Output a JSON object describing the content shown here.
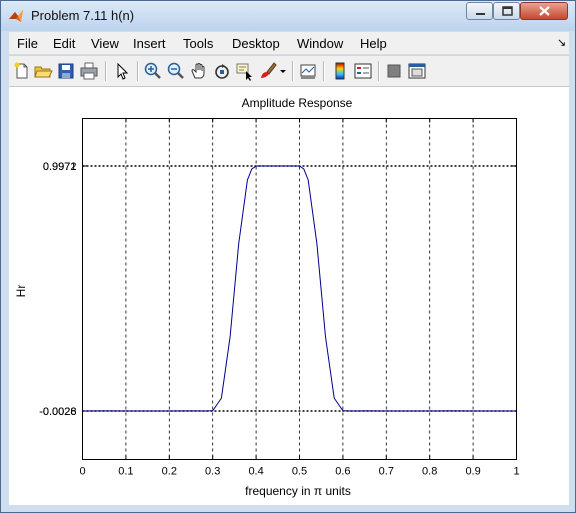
{
  "window": {
    "title": "Problem 7.11 h(n)",
    "controls": [
      "minimize",
      "maximize",
      "close"
    ]
  },
  "menubar": {
    "items": [
      "File",
      "Edit",
      "View",
      "Insert",
      "Tools",
      "Desktop",
      "Window",
      "Help"
    ],
    "dock_arrow": "↘"
  },
  "toolbar": {
    "buttons": [
      "new-figure-icon",
      "open-file-icon",
      "save-icon",
      "print-icon",
      "edit-plot-arrow-icon",
      "zoom-in-icon",
      "zoom-out-icon",
      "pan-hand-icon",
      "rotate-3d-icon",
      "data-cursor-icon",
      "brush-icon",
      "link-plot-icon",
      "colorbar-icon",
      "legend-icon",
      "hide-plot-tools-icon",
      "show-plot-tools-icon"
    ]
  },
  "chart_data": {
    "type": "line",
    "title": "Amplitude Response",
    "xlabel": "frequency in π units",
    "ylabel": "Hr",
    "xlim": [
      0,
      1
    ],
    "ylim": [
      -0.0028,
      0.9972
    ],
    "xticks": [
      0,
      0.1,
      0.2,
      0.3,
      0.4,
      0.5,
      0.6,
      0.7,
      0.8,
      0.9,
      1
    ],
    "xtick_labels": [
      "0",
      "0.1",
      "0.2",
      "0.3",
      "0.4",
      "0.5",
      "0.6",
      "0.7",
      "0.8",
      "0.9",
      "1"
    ],
    "yticks": [
      -0.0028,
      0.9972
    ],
    "ytick_labels": [
      "-0.0028",
      "0.9972"
    ],
    "overlapping_ytick_labels": [
      "-0.0026",
      "0.9971"
    ],
    "grid": true,
    "series": [
      {
        "color": "#00008b",
        "x": [
          0,
          0.05,
          0.1,
          0.15,
          0.2,
          0.25,
          0.28,
          0.3,
          0.32,
          0.34,
          0.36,
          0.38,
          0.39,
          0.4,
          0.45,
          0.5,
          0.51,
          0.52,
          0.54,
          0.56,
          0.58,
          0.6,
          0.62,
          0.65,
          0.7,
          0.75,
          0.8,
          0.85,
          0.9,
          0.95,
          1
        ],
        "y": [
          -0.0028,
          -0.0025,
          -0.0028,
          -0.0026,
          -0.0028,
          -0.0025,
          -0.0028,
          -0.002,
          0.05,
          0.3,
          0.68,
          0.94,
          0.985,
          0.9972,
          0.9972,
          0.9972,
          0.985,
          0.94,
          0.68,
          0.3,
          0.05,
          -0.002,
          -0.0028,
          -0.0025,
          -0.0028,
          -0.0026,
          -0.0028,
          -0.0025,
          -0.0028,
          -0.0026,
          -0.0028
        ]
      }
    ]
  }
}
